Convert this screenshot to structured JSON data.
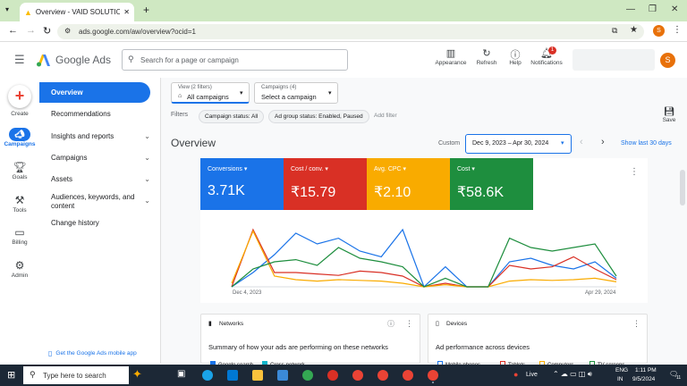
{
  "browser": {
    "tab_title": "Overview - VAID SOLUTIONS -",
    "url": "ads.google.com/aw/overview?ocid=1",
    "profile_initial": "S"
  },
  "app": {
    "name": "Google Ads",
    "search_placeholder": "Search for a page or campaign",
    "header_buttons": [
      "Appearance",
      "Refresh",
      "Help",
      "Notifications"
    ],
    "notification_count": "1",
    "profile_initial": "S"
  },
  "rail": {
    "create": "Create",
    "items": [
      "Campaigns",
      "Goals",
      "Tools",
      "Billing",
      "Admin"
    ]
  },
  "nav": {
    "items": [
      "Overview",
      "Recommendations",
      "Insights and reports",
      "Campaigns",
      "Assets",
      "Audiences, keywords, and content",
      "Change history"
    ],
    "mobile_app": "Get the Google Ads mobile app"
  },
  "filters": {
    "view_label": "View (2 filters)",
    "view_value": "All campaigns",
    "campaigns_label": "Campaigns (4)",
    "campaigns_value": "Select a campaign",
    "filters_label": "Filters",
    "chips": [
      "Campaign status: All",
      "Ad group status: Enabled, Paused"
    ],
    "add_filter": "Add filter",
    "save": "Save"
  },
  "overview": {
    "title": "Overview",
    "range_label": "Custom",
    "range_value": "Dec 9, 2023 – Apr 30, 2024",
    "show_last": "Show last 30 days"
  },
  "metrics": [
    {
      "label": "Conversions",
      "value": "3.71K",
      "color": "#1a73e8"
    },
    {
      "label": "Cost / conv.",
      "value": "₹15.79",
      "color": "#d93025"
    },
    {
      "label": "Avg. CPC",
      "value": "₹2.10",
      "color": "#f9ab00"
    },
    {
      "label": "Cost",
      "value": "₹58.6K",
      "color": "#1e8e3e"
    }
  ],
  "chart_data": {
    "type": "line",
    "x_start_label": "Dec 4, 2023",
    "x_end_label": "Apr 29, 2024",
    "series": [
      {
        "name": "Conversions",
        "color": "#1a73e8",
        "values": [
          0,
          20,
          45,
          75,
          60,
          68,
          50,
          42,
          80,
          0,
          28,
          0,
          0,
          35,
          40,
          30,
          25,
          35,
          12
        ]
      },
      {
        "name": "Cost / conv.",
        "color": "#d93025",
        "values": [
          0,
          80,
          20,
          20,
          18,
          16,
          22,
          20,
          15,
          0,
          5,
          0,
          0,
          30,
          25,
          28,
          42,
          25,
          10
        ]
      },
      {
        "name": "Avg. CPC",
        "color": "#f9ab00",
        "values": [
          5,
          78,
          15,
          10,
          8,
          10,
          9,
          8,
          5,
          0,
          3,
          0,
          0,
          8,
          10,
          9,
          10,
          12,
          7
        ]
      },
      {
        "name": "Cost",
        "color": "#1e8e3e",
        "values": [
          0,
          25,
          35,
          38,
          30,
          55,
          40,
          35,
          28,
          0,
          12,
          0,
          0,
          68,
          55,
          50,
          55,
          60,
          15
        ]
      }
    ]
  },
  "cards": {
    "networks_title": "Networks",
    "networks_sub": "Summary of how your ads are performing on these networks",
    "networks_legend": [
      "Google search",
      "Cross-network"
    ],
    "devices_title": "Devices",
    "devices_sub": "Ad performance across devices",
    "devices_legend": [
      "Mobile phones",
      "Tablets",
      "Computers",
      "TV screens"
    ]
  },
  "taskbar": {
    "search_placeholder": "Type here to search",
    "live": "Live",
    "lang_1": "ENG",
    "lang_2": "IN",
    "time": "1:11 PM",
    "date": "9/5/2024",
    "notif": "11"
  }
}
